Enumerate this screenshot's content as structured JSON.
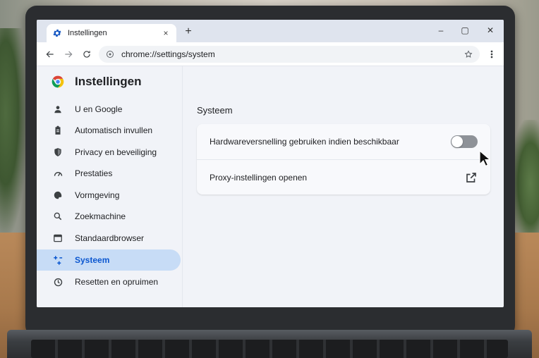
{
  "tab": {
    "title": "Instellingen",
    "close": "×",
    "new_tab": "+"
  },
  "window": {
    "minimize": "–",
    "maximize": "▢",
    "close": "✕"
  },
  "toolbar": {
    "url": "chrome://settings/system"
  },
  "sidebar": {
    "title": "Instellingen",
    "items": [
      {
        "label": "U en Google",
        "icon": "person-icon"
      },
      {
        "label": "Automatisch invullen",
        "icon": "clipboard-icon"
      },
      {
        "label": "Privacy en beveiliging",
        "icon": "shield-icon"
      },
      {
        "label": "Prestaties",
        "icon": "speedometer-icon"
      },
      {
        "label": "Vormgeving",
        "icon": "palette-icon"
      },
      {
        "label": "Zoekmachine",
        "icon": "search-icon"
      },
      {
        "label": "Standaardbrowser",
        "icon": "browser-window-icon"
      },
      {
        "label": "Systeem",
        "icon": "system-icon",
        "active": true
      },
      {
        "label": "Resetten en opruimen",
        "icon": "reset-icon"
      }
    ]
  },
  "main": {
    "section_title": "Systeem",
    "rows": [
      {
        "label": "Hardwareversnelling gebruiken indien beschikbaar",
        "control": "toggle",
        "state": "off"
      },
      {
        "label": "Proxy-instellingen openen",
        "control": "external-link-icon"
      }
    ]
  },
  "colors": {
    "accent": "#0b57d0",
    "active_bg": "#c7dcf6",
    "toggle_off": "#8e9298"
  }
}
